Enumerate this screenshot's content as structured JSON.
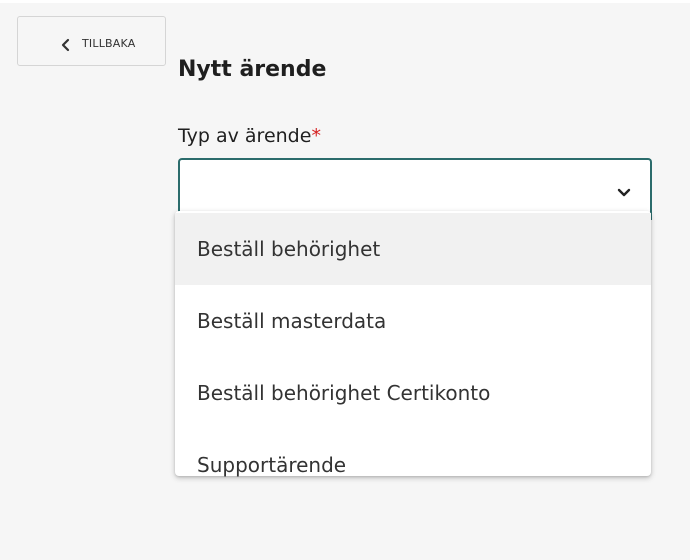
{
  "header": {
    "back_label": "TILLBAKA"
  },
  "form": {
    "title": "Nytt ärende",
    "type_label": "Typ av ärende",
    "required_marker": "*",
    "selected_value": ""
  },
  "dropdown": {
    "options": [
      {
        "label": "Beställ behörighet",
        "highlighted": true
      },
      {
        "label": "Beställ masterdata",
        "highlighted": false
      },
      {
        "label": "Beställ behörighet Certikonto",
        "highlighted": false
      },
      {
        "label": "Supportärende",
        "highlighted": false
      }
    ]
  },
  "colors": {
    "accent_border": "#2b6c6c",
    "required": "#d62020",
    "background": "#f6f6f6",
    "highlight": "#f1f1f1"
  },
  "icons": {
    "back": "chevron-left-icon",
    "select": "chevron-down-icon"
  }
}
